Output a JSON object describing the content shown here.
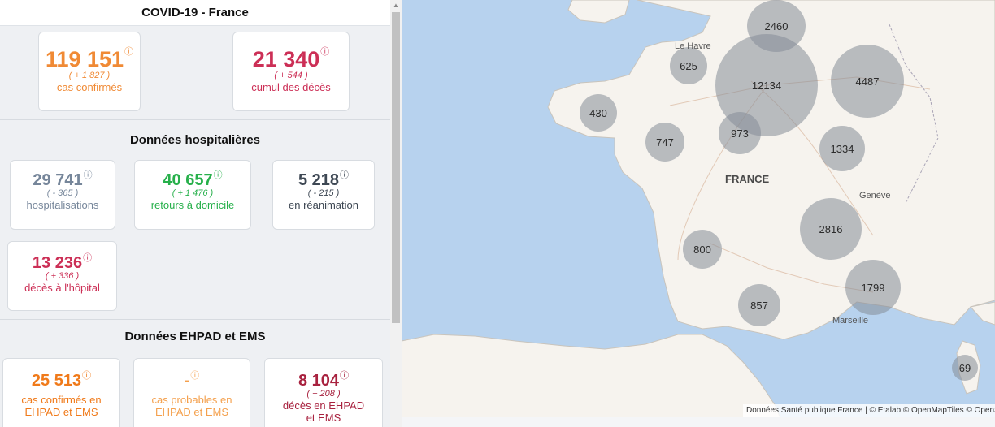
{
  "panel": {
    "title": "COVID-19 - France",
    "info_mark": "ⓘ",
    "summary": [
      {
        "value": "119 151",
        "delta": "( + 1 827 )",
        "label": "cas confirmés"
      },
      {
        "value": "21 340",
        "delta": "( + 544 )",
        "label": "cumul des décès"
      }
    ],
    "hospital_title": "Données hospitalières",
    "hospital": [
      {
        "value": "29 741",
        "delta": "( - 365 )",
        "label": "hospitalisations"
      },
      {
        "value": "40 657",
        "delta": "( + 1 476 )",
        "label": "retours à domicile"
      },
      {
        "value": "5 218",
        "delta": "( - 215 )",
        "label": "en réanimation"
      },
      {
        "value": "13 236",
        "delta": "( + 336 )",
        "label": "décès à l'hôpital"
      }
    ],
    "ehpad_title": "Données EHPAD et EMS",
    "ehpad": [
      {
        "value": "25 513",
        "label1": "cas confirmés en",
        "label2": "EHPAD et EMS"
      },
      {
        "value": "-",
        "label1": "cas probables en",
        "label2": "EHPAD et EMS"
      },
      {
        "value": "8 104",
        "delta": "( + 208 )",
        "label1": "décès en EHPAD",
        "label2": "et EMS"
      }
    ]
  },
  "map": {
    "clusters": [
      "2460",
      "625",
      "12134",
      "4487",
      "430",
      "973",
      "747",
      "1334",
      "2816",
      "800",
      "1799",
      "857",
      "69"
    ],
    "places": [
      "Le Havre",
      "Genève",
      "Marseille"
    ],
    "country": "FRANCE",
    "attribution": "Données Santé publique France | © Etalab © OpenMapTiles © OpenStreetMap"
  },
  "colors": {
    "confirmed": "#f08a35",
    "deaths": "#cc2f56",
    "hospital": "#76869a",
    "returns": "#27b04b",
    "map_water": "#b7d2ee",
    "map_land": "#f6f3ee",
    "cluster": "#858c98"
  }
}
